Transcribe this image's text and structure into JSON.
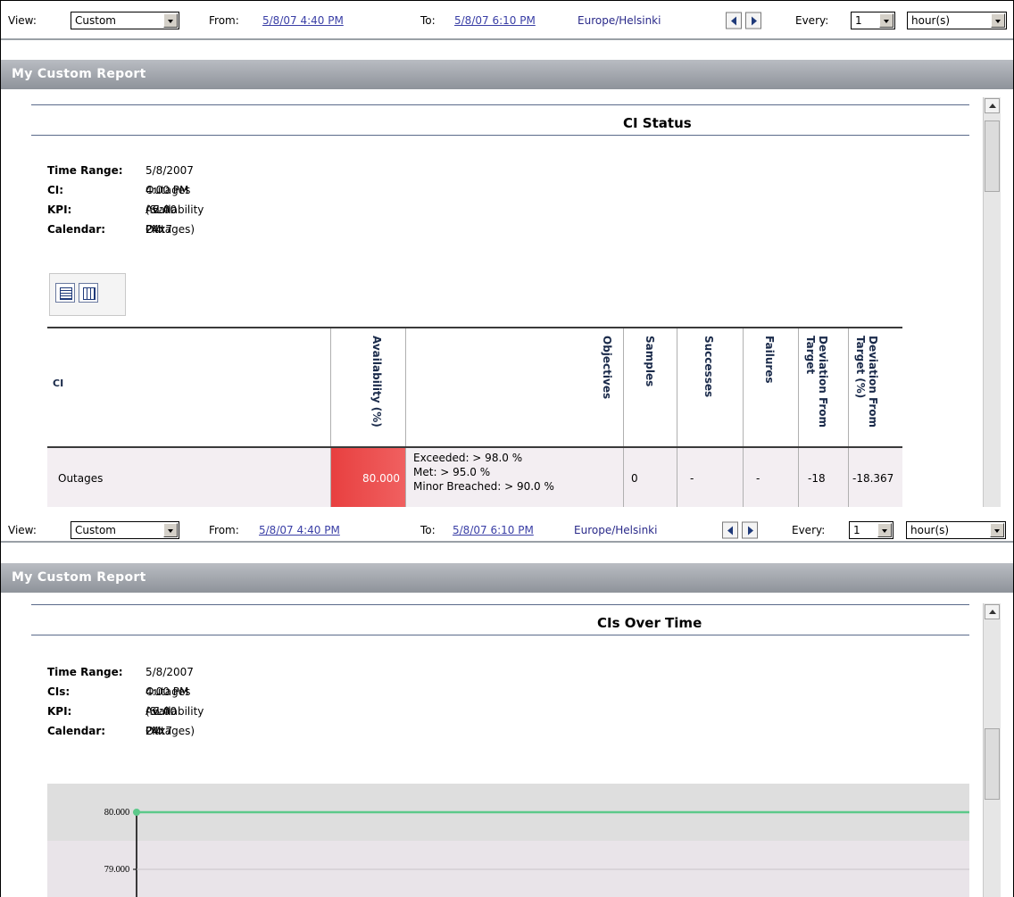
{
  "toolbar": {
    "view_label": "View:",
    "view_value": "Custom",
    "from_label": "From:",
    "from_value": "5/8/07 4:40 PM",
    "to_label": "To:",
    "to_value": "5/8/07 6:10 PM",
    "timezone": "Europe/Helsinki",
    "every_label": "Every:",
    "every_value": "1",
    "unit_value": "hour(s)"
  },
  "panel1": {
    "report_title": "My Custom Report",
    "section_title": "CI Status",
    "meta": [
      {
        "key": "Time Range:",
        "value": "5/8/2007 4:00 PM - 5:00 PM"
      },
      {
        "key": "CI:",
        "value": "Outages (SLA: Outages)"
      },
      {
        "key": "KPI:",
        "value": "Availability"
      },
      {
        "key": "Calendar:",
        "value": "24x7"
      }
    ],
    "table": {
      "headers": [
        "CI",
        "Availability (%)",
        "Objectives",
        "Samples",
        "Successes",
        "Failures",
        "Deviation From Target",
        "Deviation From Target (%)"
      ],
      "row": {
        "ci": "Outages",
        "availability": "80.000",
        "objectives": [
          "Exceeded: > 98.0 %",
          "Met: > 95.0 %",
          "Minor Breached: > 90.0 %"
        ],
        "samples": "0",
        "successes": "-",
        "failures": "-",
        "deviation": "-18",
        "deviation_pct": "-18.367"
      }
    }
  },
  "panel2": {
    "report_title": "My Custom Report",
    "section_title": "CIs Over Time",
    "meta": [
      {
        "key": "Time Range:",
        "value": "5/8/2007 4:00 PM - 6:00 PM"
      },
      {
        "key": "CIs:",
        "value": "Outages (SLA: Outages)"
      },
      {
        "key": "KPI:",
        "value": "Availability"
      },
      {
        "key": "Calendar:",
        "value": "24x7"
      }
    ],
    "chart_data": {
      "type": "line",
      "y_ticks": [
        "80.000",
        "79.000"
      ],
      "series": [
        {
          "values": [
            80.0,
            80.0
          ],
          "color": "#5cc98a"
        }
      ]
    }
  },
  "colors": {
    "header_band": "#8e939a",
    "link": "#3a3fa6",
    "breach_red": "#e84040",
    "series_line": "#5cc98a"
  }
}
